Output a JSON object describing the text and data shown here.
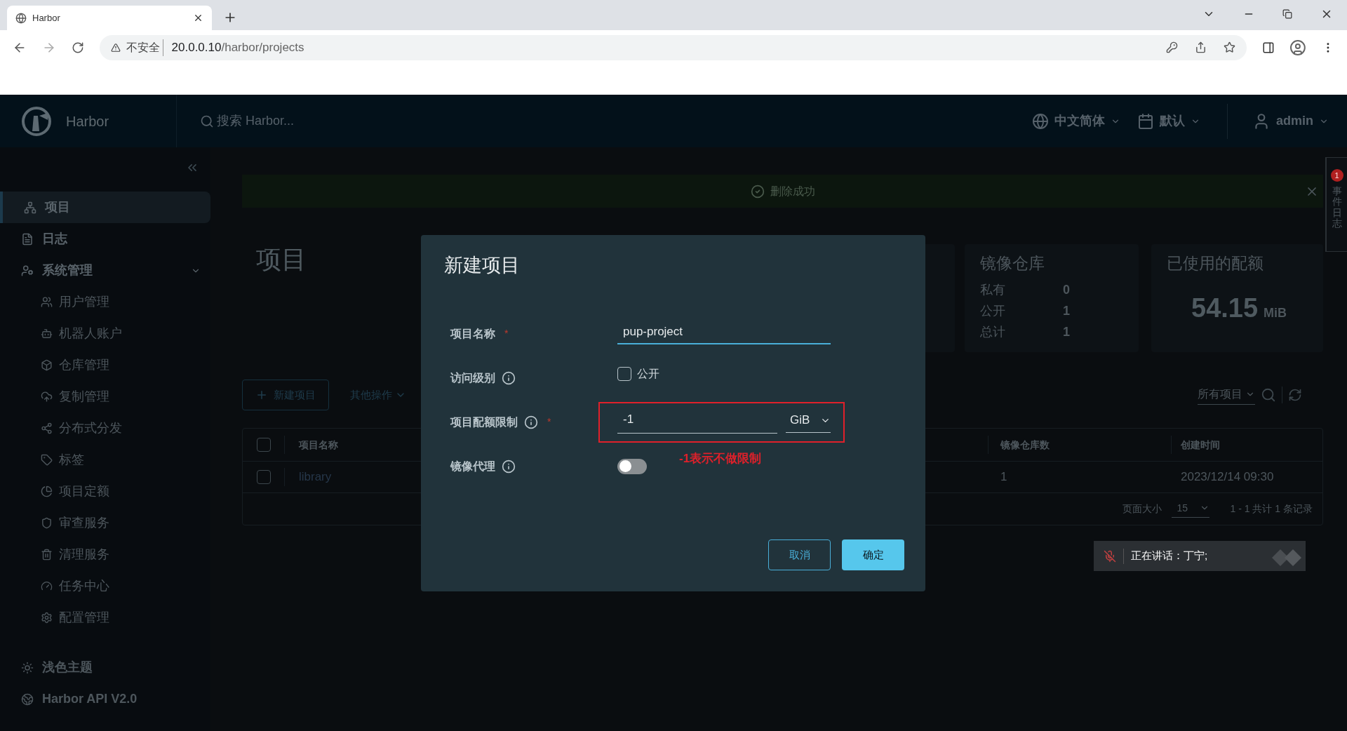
{
  "browser": {
    "tab_title": "Harbor",
    "security": "不安全",
    "host": "20.0.0.10",
    "path": "/harbor/projects"
  },
  "header": {
    "brand": "Harbor",
    "search_placeholder": "搜索 Harbor...",
    "language": "中文简体",
    "schedule": "默认",
    "user": "admin"
  },
  "sidebar": {
    "items": [
      {
        "label": "项目",
        "selected": true
      },
      {
        "label": "日志",
        "selected": false
      },
      {
        "label": "系统管理",
        "selected": false,
        "expanded": true,
        "children": [
          {
            "label": "用户管理",
            "selected": false
          },
          {
            "label": "机器人账户",
            "selected": false
          },
          {
            "label": "仓库管理",
            "selected": false
          },
          {
            "label": "复制管理",
            "selected": false
          },
          {
            "label": "分布式分发",
            "selected": false
          },
          {
            "label": "标签",
            "selected": false
          },
          {
            "label": "项目定额",
            "selected": false
          },
          {
            "label": "审查服务",
            "selected": false
          },
          {
            "label": "清理服务",
            "selected": false
          },
          {
            "label": "任务中心",
            "selected": false
          },
          {
            "label": "配置管理",
            "selected": false
          }
        ]
      }
    ],
    "footer": [
      {
        "label": "浅色主题"
      },
      {
        "label": "Harbor API V2.0"
      }
    ]
  },
  "banner": {
    "message": "删除成功"
  },
  "event_log": {
    "label": "事件日志",
    "badge": "1"
  },
  "page_title": "项目",
  "repo_card": {
    "title": "镜像仓库",
    "rows": [
      {
        "label": "私有",
        "value": "0"
      },
      {
        "label": "公开",
        "value": "1"
      },
      {
        "label": "总计",
        "value": "1"
      }
    ]
  },
  "quota_card": {
    "title": "已使用的配额",
    "value": "54.15",
    "unit": "MiB"
  },
  "toolbar": {
    "new_button": "新建项目",
    "other_actions": "其他操作",
    "filter": "所有项目"
  },
  "table": {
    "columns": [
      "项目名称",
      "镜像仓库数",
      "创建时间"
    ],
    "all_checked": false,
    "rows": [
      {
        "checked": false,
        "cells": [
          "library",
          "1",
          "2023/12/14 09:30"
        ]
      }
    ],
    "footer": {
      "page_size_label": "页面大小",
      "page_size": "15",
      "summary": "1 - 1 共计 1 条记录"
    }
  },
  "dialog": {
    "title": "新建项目",
    "fields": [
      {
        "kind": "text",
        "label": "项目名称",
        "required_mark": "*",
        "info": false,
        "value": "pup-project"
      },
      {
        "kind": "checkbox",
        "label": "访问级别",
        "info": true,
        "option": "公开",
        "checked": false
      },
      {
        "kind": "quota",
        "label": "项目配额限制",
        "required_mark": "*",
        "info": true,
        "value": "-1",
        "unit": "GiB",
        "highlighted": true,
        "note": "-1表示不做限制"
      },
      {
        "kind": "toggle",
        "label": "镜像代理",
        "info": true,
        "on": false
      }
    ],
    "cancel": "取消",
    "ok": "确定"
  },
  "toast": {
    "text": "正在讲话：丁宁;"
  }
}
